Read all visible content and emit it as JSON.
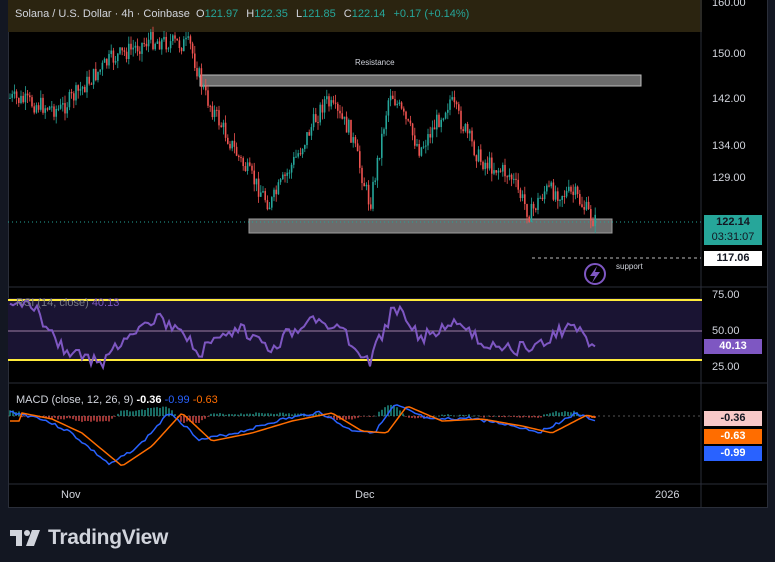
{
  "legend": {
    "symbol": "Solana / U.S. Dollar · 4h · Coinbase",
    "o_label": "O",
    "o_value": "121.97",
    "h_label": "H",
    "h_value": "122.35",
    "l_label": "L",
    "l_value": "121.85",
    "c_label": "C",
    "c_value": "122.14",
    "change": "+0.17 (+0.14%)"
  },
  "price_axis": {
    "ticks": [
      "160.00",
      "150.00",
      "142.00",
      "134.00",
      "129.00"
    ],
    "current_price": "122.14",
    "countdown": "03:31:07",
    "support_price": "117.06"
  },
  "annotations": {
    "resistance": "Resistance",
    "support": "support"
  },
  "rsi": {
    "title": "RSI (14, close)",
    "value": "40.13",
    "ticks": [
      "75.00",
      "50.00",
      "25.00"
    ],
    "current": "40.13"
  },
  "macd": {
    "title": "MACD (close, 12, 26, 9)",
    "v1": "-0.36",
    "v2": "-0.99",
    "v3": "-0.63",
    "tag_hist": "-0.36",
    "tag_signal": "-0.63",
    "tag_macd": "-0.99"
  },
  "time_axis": {
    "labels": [
      "Nov",
      "Dec",
      "2026"
    ]
  },
  "branding": {
    "name": "TradingView"
  },
  "colors": {
    "up": "#26a69a",
    "down": "#ef5350",
    "rsi_line": "#7e57c2",
    "rsi_band": "#ffeb3b",
    "macd_line": "#2962ff",
    "signal_line": "#ff6d00",
    "current_price_bg": "#26a69a"
  },
  "chart_data": {
    "type": "candlestick",
    "timeframe": "4h",
    "resistance_zone": [
      145,
      146.5
    ],
    "support_zone": [
      121,
      123.2
    ],
    "ohlc_last": {
      "open": 121.97,
      "high": 122.35,
      "low": 121.85,
      "close": 122.14
    },
    "rsi_last": 40.13,
    "macd_last": {
      "hist": -0.36,
      "macd": -0.99,
      "signal": -0.63
    }
  }
}
